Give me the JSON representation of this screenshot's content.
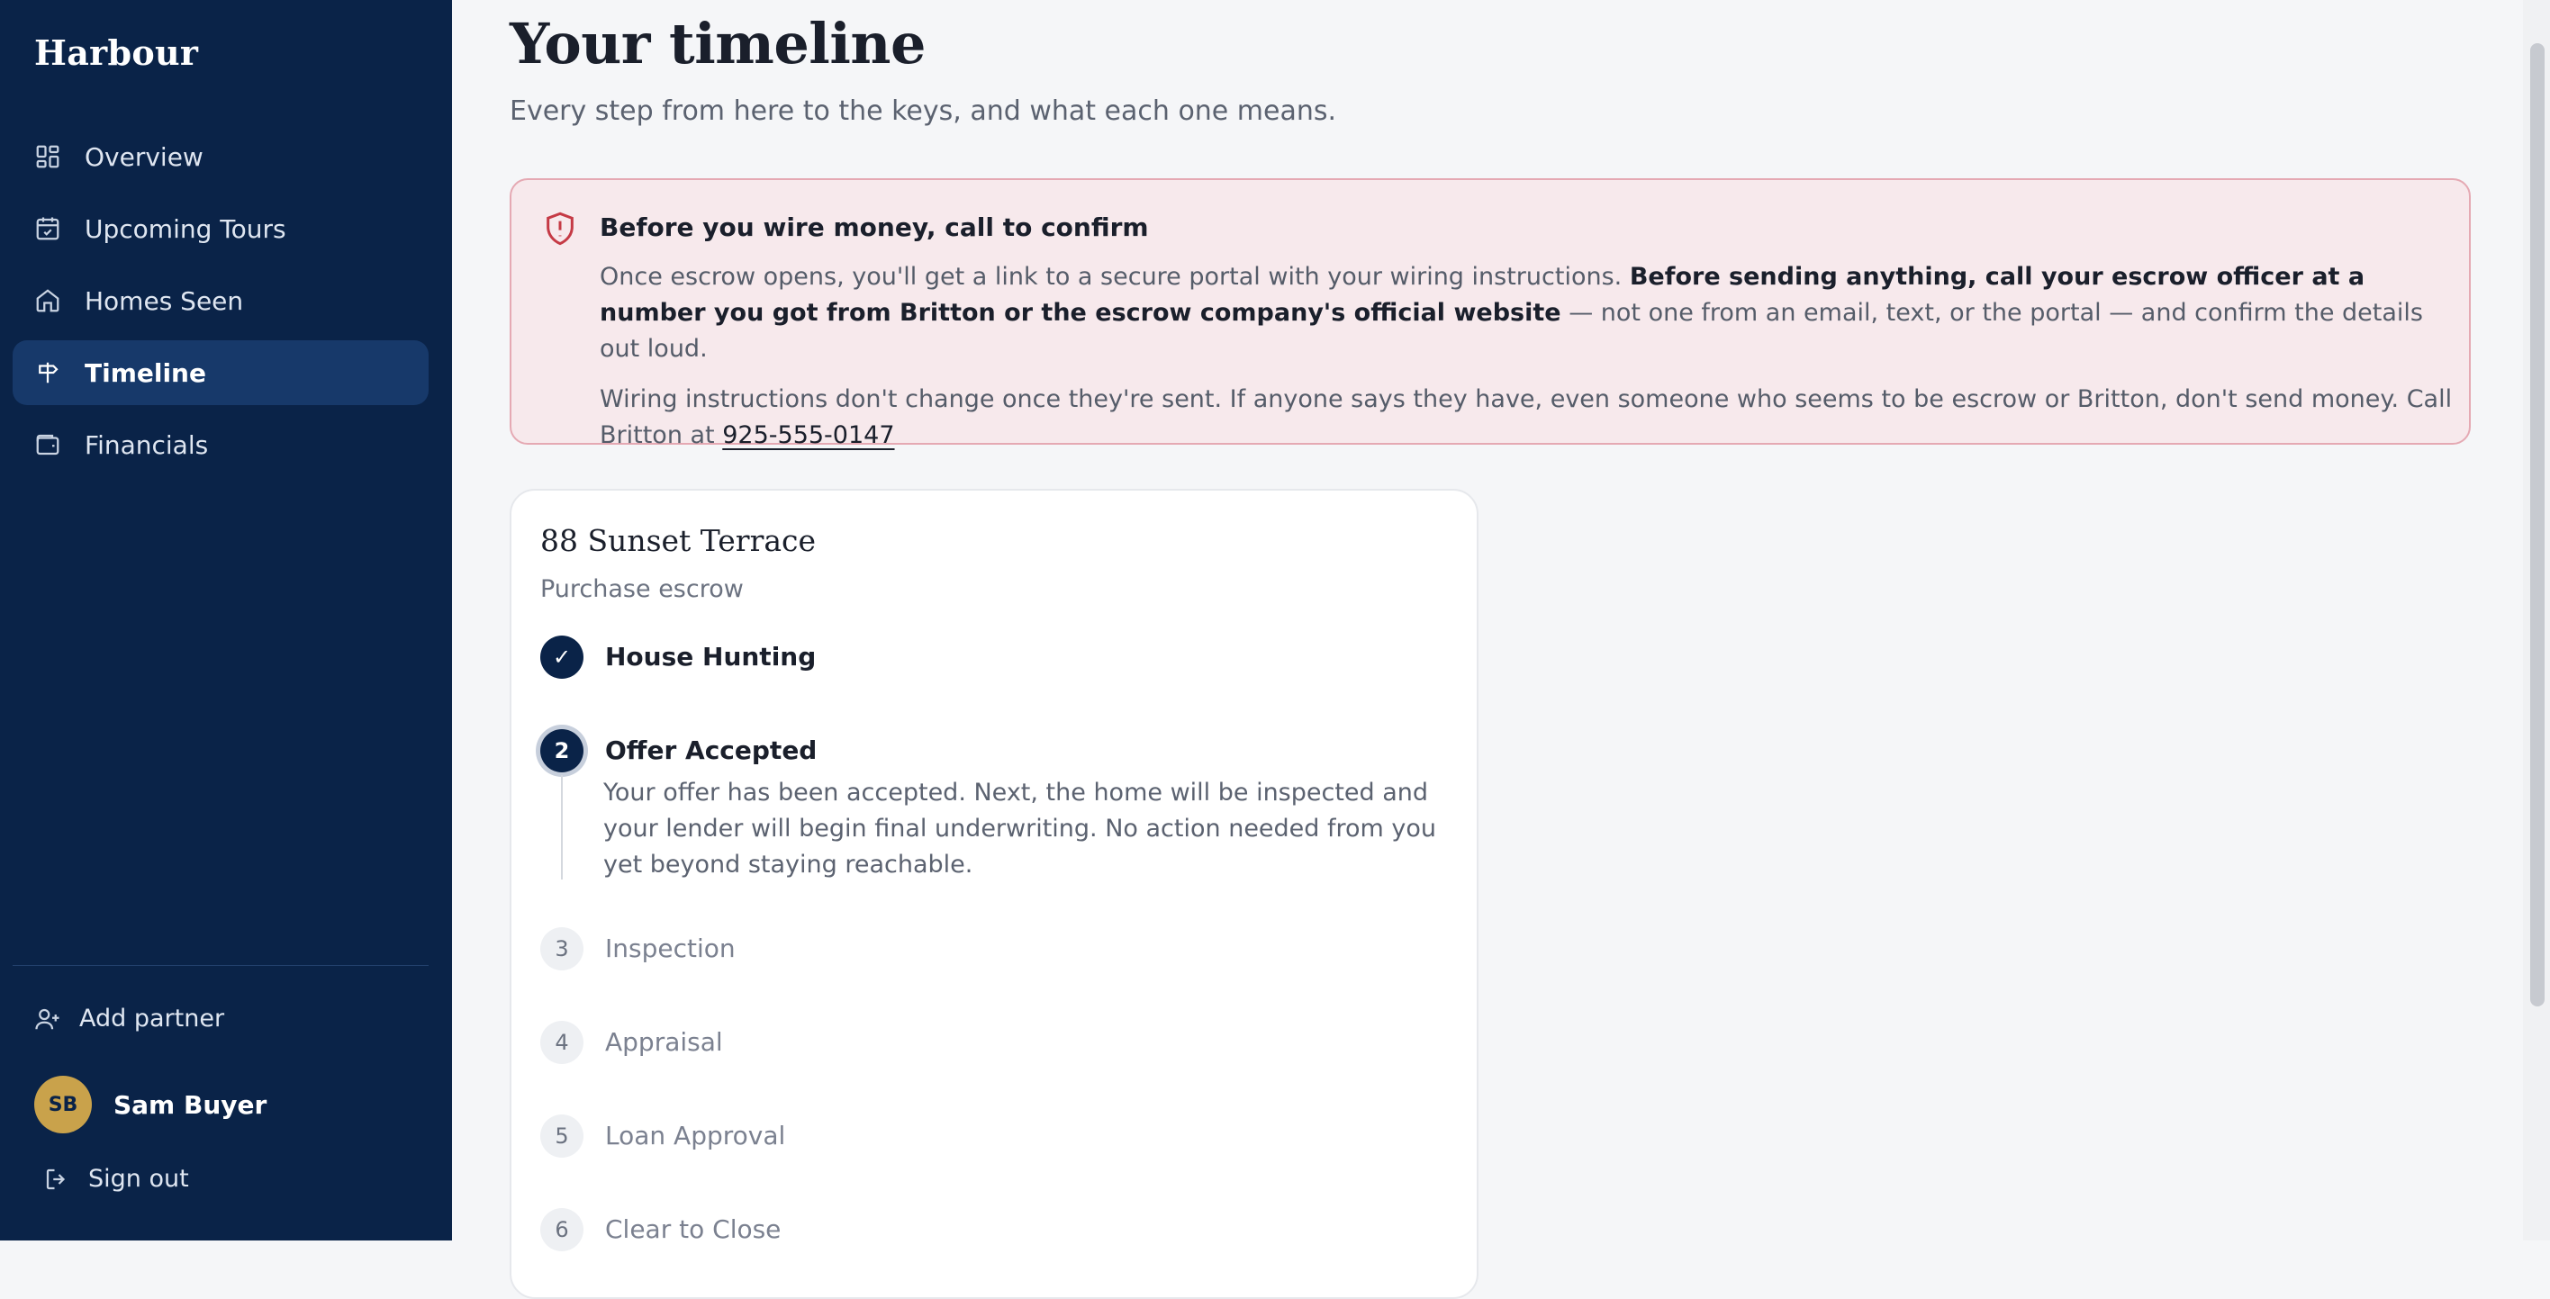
{
  "app": {
    "brand": "Harbour"
  },
  "sidebar": {
    "items": [
      {
        "label": "Overview",
        "icon": "grid-icon",
        "active": false
      },
      {
        "label": "Upcoming Tours",
        "icon": "calendar-check-icon",
        "active": false
      },
      {
        "label": "Homes Seen",
        "icon": "home-icon",
        "active": false
      },
      {
        "label": "Timeline",
        "icon": "signpost-icon",
        "active": true
      },
      {
        "label": "Financials",
        "icon": "wallet-icon",
        "active": false
      }
    ],
    "add_partner": "Add partner",
    "user": {
      "initials": "SB",
      "name": "Sam Buyer"
    },
    "sign_out": "Sign out"
  },
  "page": {
    "title": "Your timeline",
    "subtitle": "Every step from here to the keys, and what each one means."
  },
  "alert": {
    "title": "Before you wire money, call to confirm",
    "para1_a": "Once escrow opens, you'll get a link to a secure portal with your wiring instructions.",
    "para1_bold": "Before sending anything, call your escrow officer at a number you got from Britton or the escrow company's official website",
    "para1_c": "— not one from an email, text, or the portal — and confirm the details out loud.",
    "para2": "Wiring instructions don't change once they're sent. If anyone says they have, even someone who seems to be escrow or Britton, don't send money. Call Britton at",
    "phone": "925-555-0147",
    "color": "#e5a9b3"
  },
  "card": {
    "title": "88 Sunset Terrace",
    "subtitle": "Purchase escrow",
    "steps": [
      {
        "number": "✓",
        "label": "House Hunting",
        "status": "done"
      },
      {
        "number": "2",
        "label": "Offer Accepted",
        "status": "current",
        "description": "Your offer has been accepted. Next, the home will be inspected and your lender will begin final underwriting. No action needed from you yet beyond staying reachable."
      },
      {
        "number": "3",
        "label": "Inspection",
        "status": "pending"
      },
      {
        "number": "4",
        "label": "Appraisal",
        "status": "pending"
      },
      {
        "number": "5",
        "label": "Loan Approval",
        "status": "pending"
      },
      {
        "number": "6",
        "label": "Clear to Close",
        "status": "pending"
      }
    ]
  },
  "colors": {
    "sidebar": "#0a2348",
    "accent": "#c9a24b",
    "active_nav": "#17396a"
  }
}
